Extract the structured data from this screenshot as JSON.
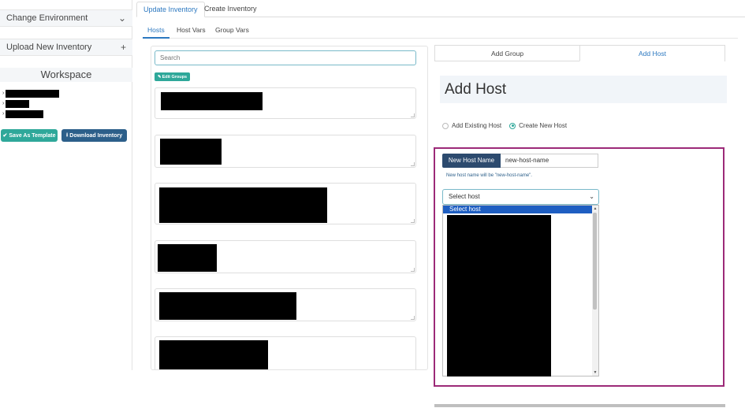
{
  "sidebar": {
    "change_env_label": "Change Environment",
    "upload_label": "Upload New Inventory",
    "workspace_title": "Workspace",
    "save_template_label": "Save As Template",
    "download_label": "Download Inventory"
  },
  "top_tabs": [
    "Update Inventory",
    "Create Inventory"
  ],
  "sub_tabs": [
    "Hosts",
    "Host Vars",
    "Group Vars"
  ],
  "host_list": {
    "search_placeholder": "Search",
    "edit_groups_label": "Edit Groups"
  },
  "add_panel": {
    "tabs": [
      "Add Group",
      "Add Host"
    ],
    "heading": "Add Host",
    "radio_existing": "Add Existing Host",
    "radio_new": "Create New Host",
    "name_prefix": "New Host Name",
    "name_value": "new-host-name",
    "hint": "New host name will be \"new-host-name\".",
    "select_value": "Select host",
    "dropdown_first_option": "Select host"
  },
  "colors": {
    "teal": "#2fa89a",
    "navy": "#2c5f8a",
    "highlight_border": "#9c2a78",
    "selected_option": "#1e5ec2"
  }
}
